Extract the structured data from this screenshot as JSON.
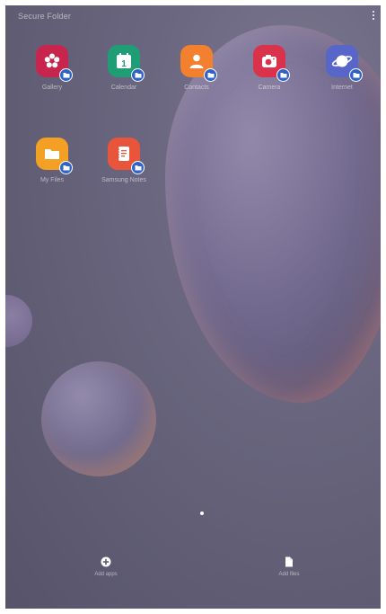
{
  "header": {
    "title": "Secure Folder"
  },
  "apps": [
    {
      "label": "Gallery",
      "icon": "gallery-icon",
      "color": "#c7254e"
    },
    {
      "label": "Calendar",
      "icon": "calendar-icon",
      "color": "#1f9d74"
    },
    {
      "label": "Contacts",
      "icon": "contacts-icon",
      "color": "#f2802f"
    },
    {
      "label": "Camera",
      "icon": "camera-icon",
      "color": "#d9324a"
    },
    {
      "label": "Internet",
      "icon": "internet-icon",
      "color": "#5866c9"
    },
    {
      "label": "My Files",
      "icon": "folder-icon",
      "color": "#f4a025"
    },
    {
      "label": "Samsung Notes",
      "icon": "notes-icon",
      "color": "#e8553b"
    }
  ],
  "calendar_day": "1",
  "badge_color": "#2f63c7",
  "actions": {
    "add_apps": "Add apps",
    "add_files": "Add files"
  },
  "corner": ""
}
